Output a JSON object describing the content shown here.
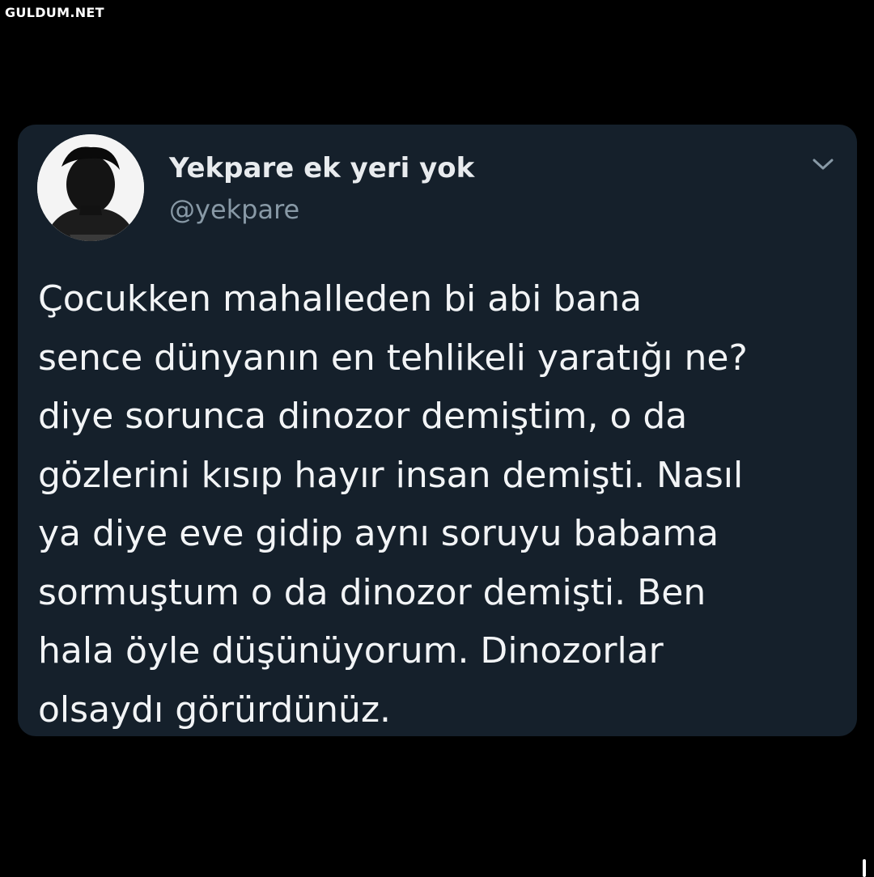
{
  "watermark": {
    "text": "GULDUM.NET"
  },
  "tweet": {
    "author": {
      "display_name": "Yekpare ek yeri yok",
      "handle": "@yekpare"
    },
    "menu_icon": "chevron-down-icon",
    "body_lines": [
      "Çocukken mahalleden bi abi bana",
      "sence dünyanın en tehlikeli yaratığı ne?",
      "diye sorunca dinozor demiştim, o da",
      "gözlerini kısıp hayır insan demişti. Nasıl",
      "ya diye eve gidip aynı soruyu babama",
      "sormuştum o da dinozor demişti. Ben",
      "hala öyle düşünüyorum. Dinozorlar",
      "olsaydı görürdünüz."
    ]
  },
  "colors": {
    "page_background": "#000000",
    "card_background": "#15202b",
    "primary_text": "#f2f4f6",
    "secondary_text": "#8899a6"
  }
}
